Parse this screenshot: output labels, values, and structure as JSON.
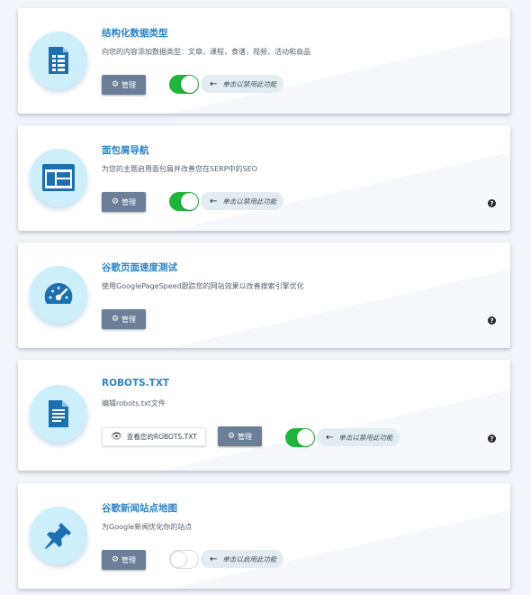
{
  "cards": [
    {
      "icon": "table-document-icon",
      "title": "结构化数据类型",
      "desc": "向您的内容添加数据类型：文章，课程，食谱，视频，活动和商品",
      "manage_label": "管理",
      "toggle": "on",
      "hint": "单击以禁用此功能"
    },
    {
      "icon": "breadcrumb-window-icon",
      "title": "面包屑导航",
      "desc": "为您的主题启用面包屑并改善您在SERP中的SEO",
      "manage_label": "管理",
      "toggle": "on",
      "hint": "单击以禁用此功能",
      "help": "?"
    },
    {
      "icon": "speedometer-icon",
      "title": "谷歌页面速度测试",
      "desc": "使用GooglePageSpeed跟踪您的网站效果以改善搜索引擎优化",
      "manage_label": "管理",
      "help": "?"
    },
    {
      "icon": "text-file-icon",
      "title": "ROBOTS.TXT",
      "desc": "编辑robots.txt文件",
      "view_label": "查看您的ROBOTS.TXT",
      "manage_label": "管理",
      "toggle": "on",
      "hint": "单击以禁用此功能",
      "help": "?"
    },
    {
      "icon": "pushpin-icon",
      "title": "谷歌新闻站点地图",
      "desc": "为Google新闻优化你的站点",
      "manage_label": "管理",
      "toggle": "off",
      "hint": "单击以启用此功能"
    }
  ],
  "colors": {
    "accent": "#2d84c5",
    "icon_blue": "#1e6fb0",
    "icon_bg": "#cdeffc",
    "toggle_on": "#1fb53a",
    "button": "#6b7f99"
  }
}
